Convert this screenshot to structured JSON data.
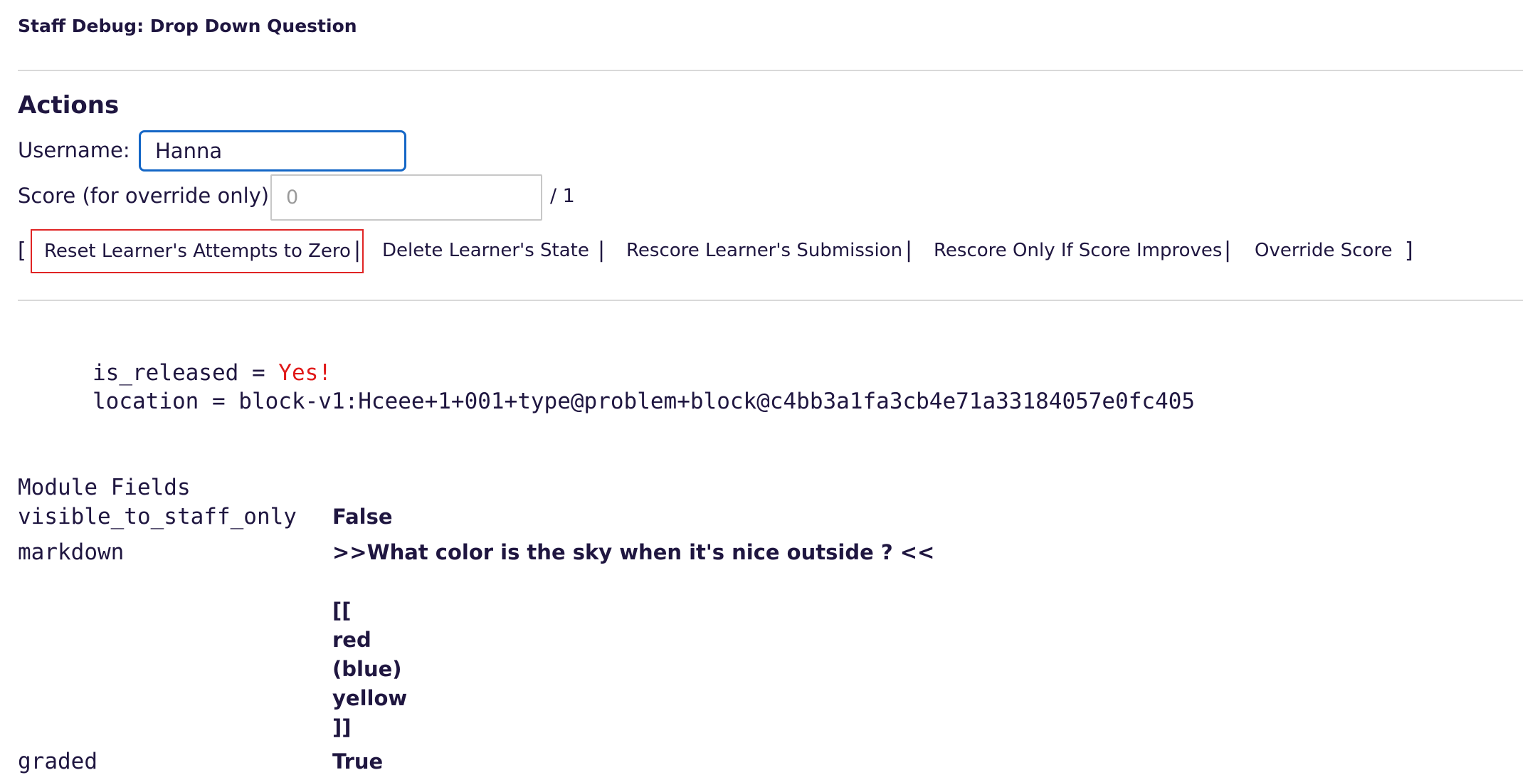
{
  "header": {
    "title": "Staff Debug: Drop Down Question"
  },
  "actions": {
    "title": "Actions",
    "username_label": "Username:",
    "username_value": "Hanna",
    "score_label": "Score (for override only):",
    "score_placeholder": "0",
    "score_max": "/ 1",
    "bracket_open": "[",
    "bracket_close": "]",
    "separator": "|",
    "links": [
      {
        "label": "Reset Learner's Attempts to Zero"
      },
      {
        "label": "Delete Learner's State"
      },
      {
        "label": "Rescore Learner's Submission"
      },
      {
        "label": "Rescore Only If Score Improves"
      },
      {
        "label": "Override Score"
      }
    ]
  },
  "info": {
    "released_key": "is_released = ",
    "released_value": "Yes!",
    "location_text": "location = block-v1:Hceee+1+001+type@problem+block@c4bb3a1fa3cb4e71a33184057e0fc405"
  },
  "module_fields": {
    "title": "Module Fields",
    "rows": [
      {
        "key": "visible_to_staff_only",
        "value": "False"
      },
      {
        "key": "markdown",
        "value": ">>What color is the sky when it's nice outside ? <<\n\n[[\nred\n(blue)\nyellow\n]]"
      },
      {
        "key": "graded",
        "value": "True"
      }
    ]
  },
  "colors": {
    "text": "#1f1640",
    "input_focus_border": "#1466c6",
    "highlight_border": "#e02424",
    "released_value": "#e01919",
    "divider": "#d9d9d9"
  }
}
